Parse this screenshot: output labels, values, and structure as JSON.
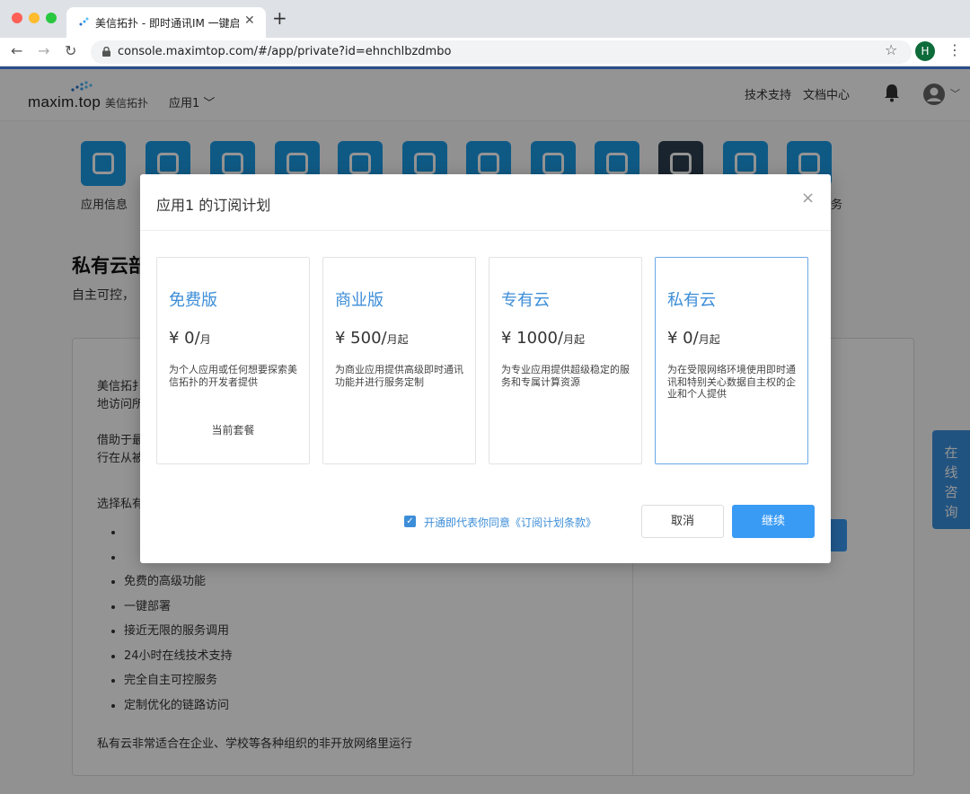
{
  "browser": {
    "tab_title": "美信拓扑 - 即时通讯IM 一键启用",
    "url": "console.maximtop.com/#/app/private?id=ehnchlbzdmbo",
    "profile_initial": "H"
  },
  "header": {
    "logo_word": "maxim.top",
    "logo_cn": "美信拓扑",
    "app_select": "应用1 ﹀",
    "link_support": "技术支持",
    "link_docs": "文档中心"
  },
  "icon_row": {
    "first_label": "应用信息",
    "last_label_tail": "务"
  },
  "page": {
    "title": "私有云部",
    "subtitle": "自主可控，",
    "para1_line1": "美信拓扌",
    "para1_line2": "地访问所",
    "para2_line1": "借助于最",
    "para2_line2": "行在从被",
    "para3": "选择私有",
    "features": [
      "",
      "",
      "免费的高级功能",
      "一键部署",
      "接近无限的服务调用",
      "24小时在线技术支持",
      "完全自主可控服务",
      "定制优化的链路访问"
    ],
    "footer": "私有云非常适合在企业、学校等各种组织的非开放网络里运行"
  },
  "side_consult": [
    "在",
    "线",
    "咨",
    "询"
  ],
  "modal": {
    "title": "应用1 的订阅计划",
    "close": "×",
    "plans": [
      {
        "name": "免费版",
        "price": "¥ 0/",
        "unit": "月",
        "desc": "为个人应用或任何想要探索美信拓扑的开发者提供",
        "status": "当前套餐"
      },
      {
        "name": "商业版",
        "price": "¥ 500/",
        "unit": "月起",
        "desc": "为商业应用提供高级即时通讯功能并进行服务定制",
        "status": ""
      },
      {
        "name": "专有云",
        "price": "¥ 1000/",
        "unit": "月起",
        "desc": "为专业应用提供超级稳定的服务和专属计算资源",
        "status": ""
      },
      {
        "name": "私有云",
        "price": "¥ 0/",
        "unit": "月起",
        "desc": "为在受限网络环境使用即时通讯和特别关心数据自主权的企业和个人提供",
        "status": ""
      }
    ],
    "agree_text": "开通即代表你同意《订阅计划条款》",
    "agree_checked": true,
    "cancel_label": "取消",
    "continue_label": "继续",
    "accent_color": "#3a9bf4"
  }
}
